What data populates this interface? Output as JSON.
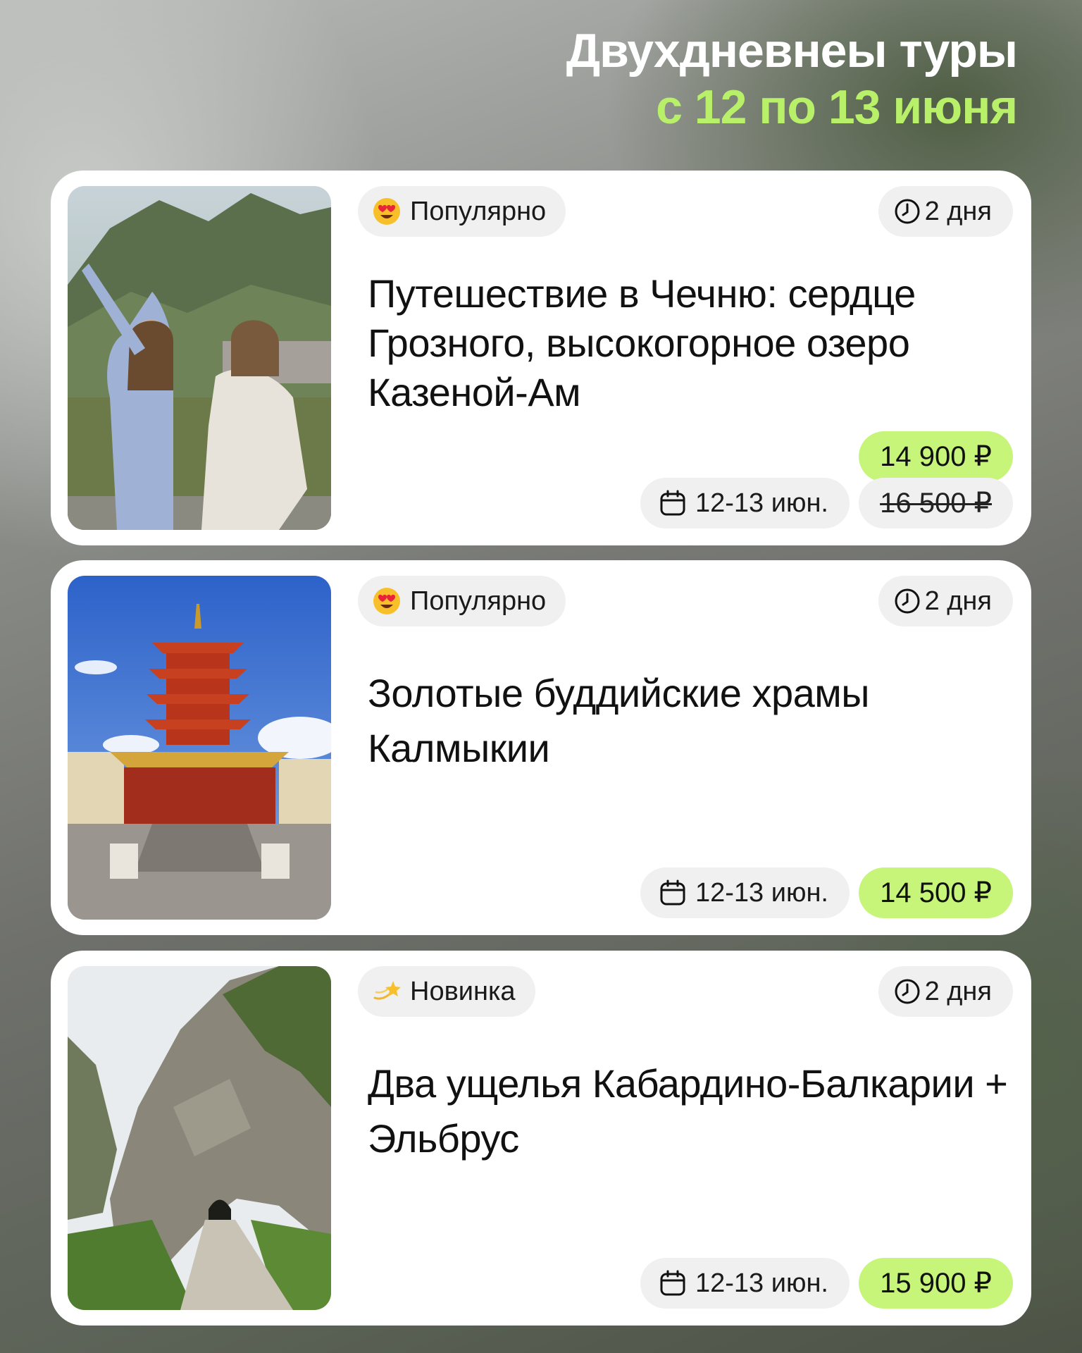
{
  "header": {
    "title": "Двухдневнеы туры",
    "subtitle": "с 12 по 13 июня"
  },
  "colors": {
    "accent_green": "#c6f57a",
    "subtitle_green": "#b9f06a",
    "chip_gray": "#f0f0f0"
  },
  "tours": [
    {
      "tag": "Популярно",
      "tag_icon": "heart-eyes-emoji-icon",
      "duration": "2 дня",
      "title": "Путешествие в Чечню: сердце Грозного, высокогорное озеро Казеной-Ам",
      "dates": "12-13 июн.",
      "price": "14 900 ₽",
      "old_price": "16 500 ₽",
      "photo": "two-women-in-mountains-photo"
    },
    {
      "tag": "Популярно",
      "tag_icon": "heart-eyes-emoji-icon",
      "duration": "2 дня",
      "title": "Золотые буддийские храмы Калмыкии",
      "dates": "12-13 июн.",
      "price": "14 500 ₽",
      "photo": "pagoda-photo"
    },
    {
      "tag": "Новинка",
      "tag_icon": "dizzy-star-emoji-icon",
      "duration": "2 дня",
      "title": "Два ущелья Кабардино-Балкарии + Эльбрус",
      "dates": "12-13 июн.",
      "price": "15 900 ₽",
      "photo": "gorge-tunnel-photo"
    }
  ]
}
